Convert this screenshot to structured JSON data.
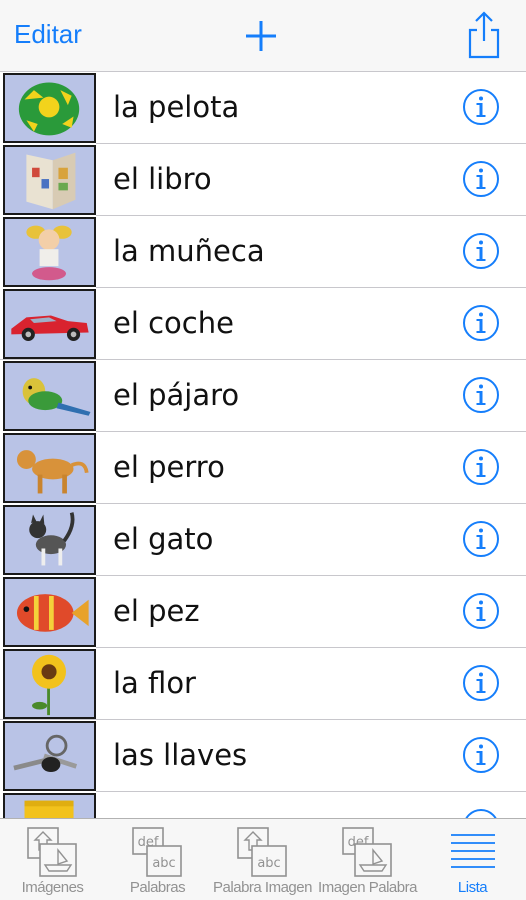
{
  "navbar": {
    "edit_label": "Editar",
    "add_icon": "plus-icon",
    "share_icon": "share-icon"
  },
  "items": [
    {
      "word": "la pelota",
      "image": "soccer-ball"
    },
    {
      "word": "el libro",
      "image": "book"
    },
    {
      "word": "la muñeca",
      "image": "doll"
    },
    {
      "word": "el coche",
      "image": "red-car"
    },
    {
      "word": "el pájaro",
      "image": "parakeet"
    },
    {
      "word": "el perro",
      "image": "dog"
    },
    {
      "word": "el gato",
      "image": "cat"
    },
    {
      "word": "el pez",
      "image": "fish"
    },
    {
      "word": "la flor",
      "image": "sunflower"
    },
    {
      "word": "las llaves",
      "image": "keys"
    },
    {
      "word": "",
      "image": "yellow-cup"
    }
  ],
  "tabs": [
    {
      "label": "Imágenes",
      "icon": "images-tab-icon",
      "active": false
    },
    {
      "label": "Palabras",
      "icon": "words-tab-icon",
      "active": false
    },
    {
      "label": "Palabra Imagen",
      "icon": "word-image-tab-icon",
      "active": false
    },
    {
      "label": "Imagen Palabra",
      "icon": "image-word-tab-icon",
      "active": false
    },
    {
      "label": "Lista",
      "icon": "list-tab-icon",
      "active": true
    }
  ],
  "colors": {
    "accent": "#157efb",
    "tab_inactive": "#929292",
    "thumb_bg": "#b9c3e6"
  }
}
